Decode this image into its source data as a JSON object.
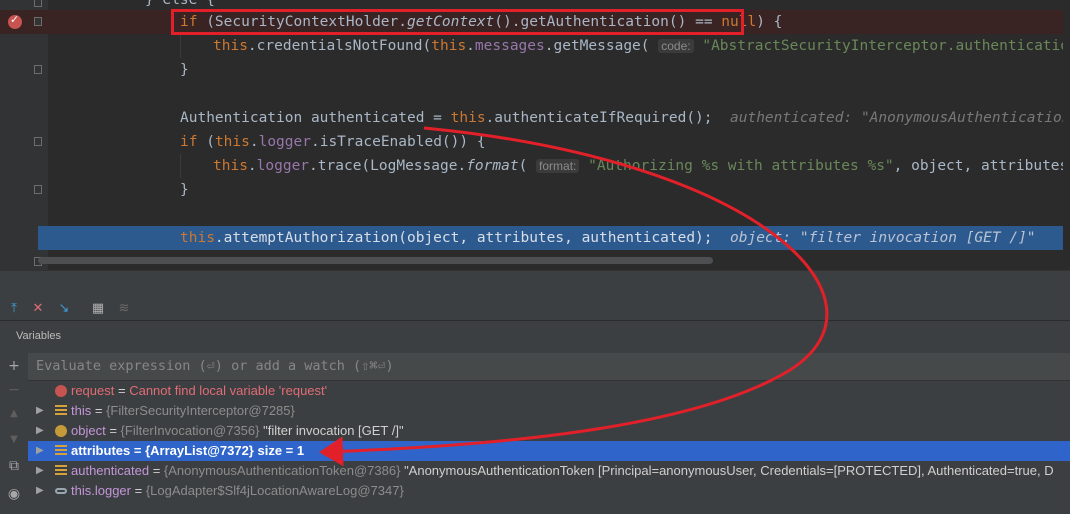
{
  "editor": {
    "top_partial": "} else {",
    "line1": {
      "kw": "if",
      "pre": " (SecurityContextHolder.",
      "method": "getContext",
      "mid": "().getAuthentication() ",
      "op": "==",
      "sp": " ",
      "null": "null",
      "close": ")",
      "brace": " {"
    },
    "line2": {
      "this": "this",
      "call": ".credentialsNotFound(",
      "this2": "this",
      "dot": ".",
      "messages": "messages",
      "getMessage": ".getMessage(",
      "param_hint": "code:",
      "str": "\"AbstractSecurityInterceptor.authenticationNotFound\""
    },
    "line3": "}",
    "line4": {
      "code": "Authentication authenticated = ",
      "this": "this",
      "rest": ".authenticateIfRequired();",
      "hint": "authenticated: \"AnonymousAuthenticationToken [Princi"
    },
    "line5": {
      "kw": "if",
      "open": " (",
      "this": "this",
      "dot": ".",
      "logger": "logger",
      "rest": ".isTraceEnabled()) {"
    },
    "line6": {
      "this": "this",
      "dot": ".",
      "logger": "logger",
      "trace": ".trace(LogMessage.",
      "format": "format",
      "paren": "(",
      "param_hint": "format:",
      "str": "\"Authorizing %s with attributes %s\"",
      "rest": ", object, attributes));"
    },
    "line7": "}",
    "line8": {
      "this": "this",
      "rest": ".attemptAuthorization(object, attributes, authenticated);",
      "hint": "object: \"filter invocation [GET /]\"    auth"
    }
  },
  "debugger": {
    "panel_title": "Variables",
    "eval_placeholder": "Evaluate expression (⏎) or add a watch (⇧⌘⏎)",
    "variables": [
      {
        "name": "request",
        "sep": " = ",
        "value": "Cannot find local variable 'request'",
        "type": "",
        "error": true,
        "icon": "error-icon"
      },
      {
        "name": "this",
        "sep": " = ",
        "type": "{FilterSecurityInterceptor@7285}",
        "value": "",
        "icon": "field-icon"
      },
      {
        "name": "object",
        "sep": " = ",
        "type": "{FilterInvocation@7356}",
        "value": " \"filter invocation [GET /]\"",
        "icon": "param-icon"
      },
      {
        "name": "attributes",
        "sep": " = ",
        "type": "{ArrayList@7372}",
        "value": "  size = 1",
        "icon": "list-icon",
        "selected": true
      },
      {
        "name": "authenticated",
        "sep": " = ",
        "type": "{AnonymousAuthenticationToken@7386}",
        "value": " \"AnonymousAuthenticationToken [Principal=anonymousUser, Credentials=[PROTECTED], Authenticated=true, D",
        "icon": "list-icon"
      },
      {
        "name": "this.logger",
        "sep": " = ",
        "type": "{LogAdapter$Slf4jLocationAwareLog@7347}",
        "value": "",
        "icon": "watch-icon"
      }
    ]
  },
  "colors": {
    "annotation_red": "#e2202a",
    "selection_blue": "#2f65ca",
    "exec_line": "#2d5a8e"
  }
}
